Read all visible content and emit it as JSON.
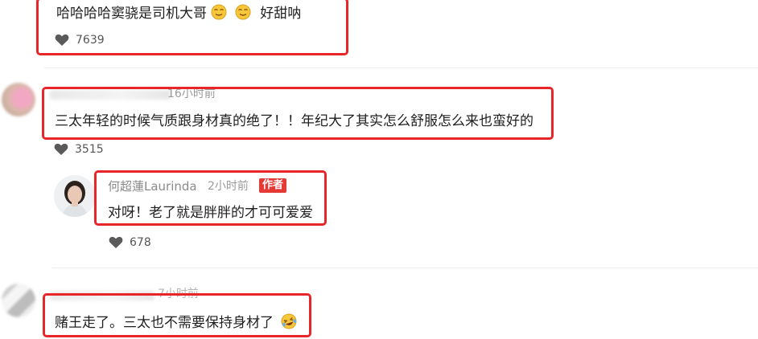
{
  "comments": [
    {
      "text_main": "哈哈哈哈窦骁是司机大哥",
      "text_tail": "好甜呐",
      "emojis": [
        "smirk-face-icon",
        "smirk-face-icon"
      ],
      "likes": "7639"
    },
    {
      "time": "16小时前",
      "text": "三太年轻的时候气质跟身材真的绝了！！年纪大了其实怎么舒服怎么来也蛮好的",
      "likes": "3515",
      "reply": {
        "author": "何超蓮Laurinda",
        "time": "2小时前",
        "badge": "作者",
        "text": "对呀！老了就是胖胖的才可可爱爱",
        "likes": "678"
      }
    },
    {
      "time_partial": "7小时前",
      "text": "赌王走了。三太也不需要保持身材了",
      "emojis": [
        "laughing-tears-face-icon"
      ]
    }
  ],
  "colors": {
    "highlight": "#e8262a",
    "badge": "#e53935",
    "divider": "#ececec"
  }
}
